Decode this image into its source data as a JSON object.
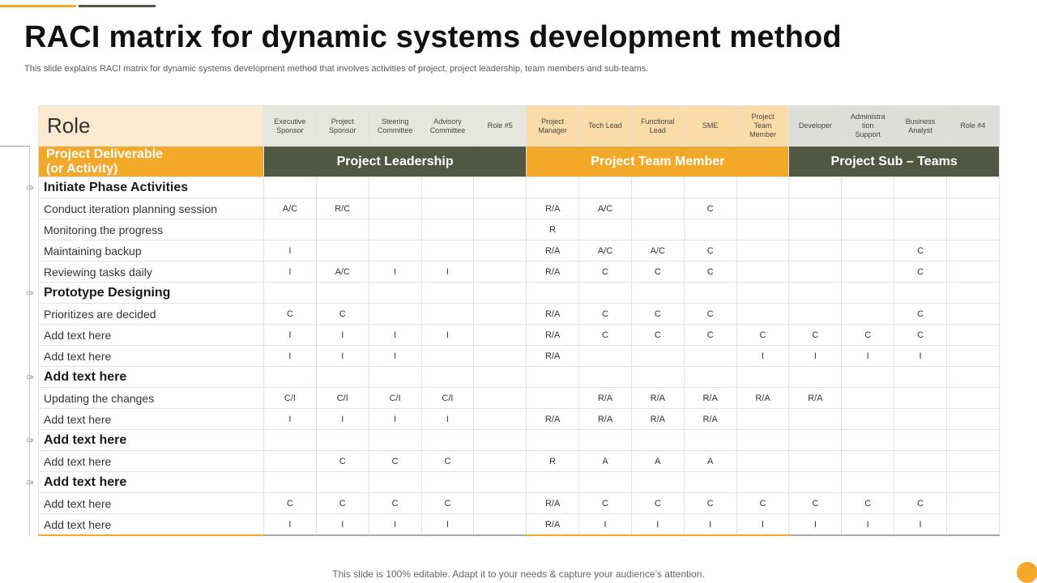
{
  "title": "RACI matrix for dynamic systems development method",
  "subtitle": "This slide explains RACI matrix for dynamic systems development method that involves activities of project, project leadership, team members and sub-teams.",
  "footer": "This slide is 100% editable. Adapt it to your needs & capture your audience’s attention.",
  "colors": {
    "accent": "#f2a92a",
    "dark": "#505843"
  },
  "table": {
    "role_label": "Role",
    "deliverable_label": "Project Deliverable\n(or Activity)",
    "columns": [
      {
        "label": "Executive\nSponsor",
        "group": "lead"
      },
      {
        "label": "Project\nSponsor",
        "group": "lead"
      },
      {
        "label": "Steering\nCommittee",
        "group": "lead"
      },
      {
        "label": "Advisory\nCommittee",
        "group": "lead"
      },
      {
        "label": "Role #5",
        "group": "lead"
      },
      {
        "label": "Project\nManager",
        "group": "team"
      },
      {
        "label": "Tech Lead",
        "group": "team"
      },
      {
        "label": "Functional\nLead",
        "group": "team"
      },
      {
        "label": "SME",
        "group": "team"
      },
      {
        "label": "Project\nTeam\nMember",
        "group": "team"
      },
      {
        "label": "Developer",
        "group": "sub"
      },
      {
        "label": "Administra\ntion\nSupport",
        "group": "sub"
      },
      {
        "label": "Business\nAnalyst",
        "group": "sub"
      },
      {
        "label": "Role #4",
        "group": "sub"
      }
    ],
    "groups": [
      {
        "label": "Project Leadership",
        "span": 5,
        "kind": "lead"
      },
      {
        "label": "Project Team Member",
        "span": 5,
        "kind": "team"
      },
      {
        "label": "Project Sub – Teams",
        "span": 4,
        "kind": "sub"
      }
    ],
    "rows": [
      {
        "type": "phase",
        "label": "Initiate Phase Activities"
      },
      {
        "type": "activity",
        "label": "Conduct iteration planning session",
        "cells": [
          "A/C",
          "R/C",
          "",
          "",
          "",
          "R/A",
          "A/C",
          "",
          "C",
          "",
          "",
          "",
          "",
          ""
        ]
      },
      {
        "type": "activity",
        "label": "Monitoring the progress",
        "cells": [
          "",
          "",
          "",
          "",
          "",
          "R",
          "",
          "",
          "",
          "",
          "",
          "",
          "",
          ""
        ]
      },
      {
        "type": "activity",
        "label": "Maintaining backup",
        "cells": [
          "I",
          "",
          "",
          "",
          "",
          "R/A",
          "A/C",
          "A/C",
          "C",
          "",
          "",
          "",
          "C",
          ""
        ]
      },
      {
        "type": "activity",
        "label": "Reviewing tasks daily",
        "cells": [
          "I",
          "A/C",
          "I",
          "I",
          "",
          "R/A",
          "C",
          "C",
          "C",
          "",
          "",
          "",
          "C",
          ""
        ]
      },
      {
        "type": "phase",
        "label": "Prototype Designing"
      },
      {
        "type": "activity",
        "label": "Prioritizes are  decided",
        "cells": [
          "C",
          "C",
          "",
          "",
          "",
          "R/A",
          "C",
          "C",
          "C",
          "",
          "",
          "",
          "C",
          ""
        ]
      },
      {
        "type": "activity",
        "label": "Add text here",
        "cells": [
          "I",
          "I",
          "I",
          "I",
          "",
          "R/A",
          "C",
          "C",
          "C",
          "C",
          "C",
          "C",
          "C",
          ""
        ]
      },
      {
        "type": "activity",
        "label": "Add text here",
        "cells": [
          "I",
          "I",
          "I",
          "",
          "",
          "R/A",
          "",
          "",
          "",
          "I",
          "I",
          "I",
          "I",
          ""
        ]
      },
      {
        "type": "phase",
        "label": "Add text here"
      },
      {
        "type": "activity",
        "label": "Updating the changes",
        "cells": [
          "C/I",
          "C/I",
          "C/I",
          "C/I",
          "",
          "",
          "R/A",
          "R/A",
          "R/A",
          "R/A",
          "R/A",
          "",
          "",
          ""
        ]
      },
      {
        "type": "activity",
        "label": "Add text here",
        "cells": [
          "I",
          "I",
          "I",
          "I",
          "",
          "R/A",
          "R/A",
          "R/A",
          "R/A",
          "",
          "",
          "",
          "",
          ""
        ]
      },
      {
        "type": "phase",
        "label": "Add text here"
      },
      {
        "type": "activity",
        "label": "Add text here",
        "cells": [
          "",
          "C",
          "C",
          "C",
          "",
          "R",
          "A",
          "A",
          "A",
          "",
          "",
          "",
          "",
          ""
        ]
      },
      {
        "type": "phase",
        "label": "Add text here"
      },
      {
        "type": "activity",
        "label": "Add text here",
        "cells": [
          "C",
          "C",
          "C",
          "C",
          "",
          "R/A",
          "C",
          "C",
          "C",
          "C",
          "C",
          "C",
          "C",
          ""
        ]
      },
      {
        "type": "activity",
        "label": "Add text here",
        "cells": [
          "I",
          "I",
          "I",
          "I",
          "",
          "R/A",
          "I",
          "I",
          "I",
          "I",
          "I",
          "I",
          "I",
          ""
        ]
      }
    ]
  }
}
